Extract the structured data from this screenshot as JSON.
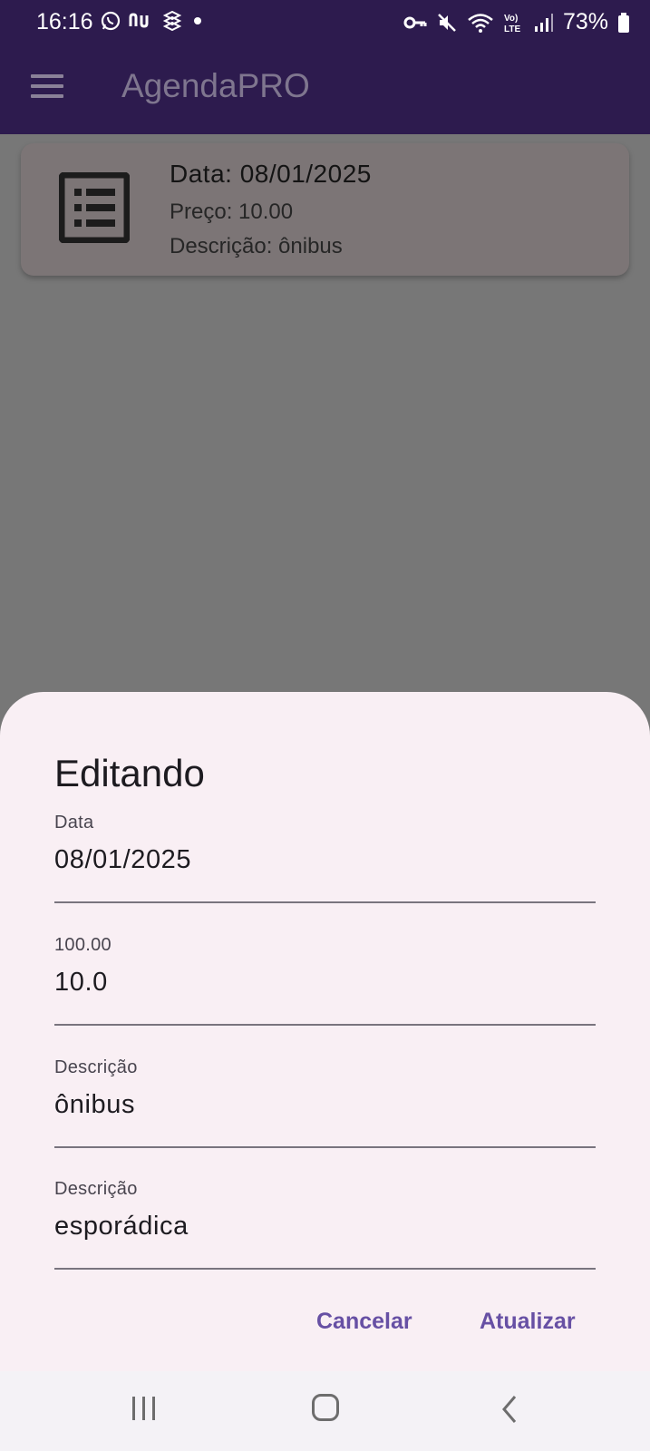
{
  "status_bar": {
    "time": "16:16",
    "battery": "73%",
    "left_icons": [
      "whatsapp-icon",
      "nubank-icon",
      "app-icon",
      "dot-icon"
    ],
    "right_icons": [
      "key-icon",
      "mute-icon",
      "wifi-icon",
      "volte-icon",
      "signal-icon",
      "battery-icon"
    ]
  },
  "app_bar": {
    "title": "AgendaPRO"
  },
  "card": {
    "date": "Data: 08/01/2025",
    "price": "Preço: 10.00",
    "description": "Descrição: ônibus",
    "icon": "list-alt-icon"
  },
  "dialog": {
    "title": "Editando",
    "fields": [
      {
        "label": "Data",
        "value": "08/01/2025"
      },
      {
        "label": "100.00",
        "value": "10.0"
      },
      {
        "label": "Descrição",
        "value": "ônibus"
      },
      {
        "label": "Descrição",
        "value": "esporádica"
      }
    ],
    "cancel_label": "Cancelar",
    "update_label": "Atualizar"
  },
  "colors": {
    "app_bar": "#2d1b4e",
    "sheet_background": "#f9eff4",
    "accent": "#6750a4",
    "scrim": "#777777"
  }
}
